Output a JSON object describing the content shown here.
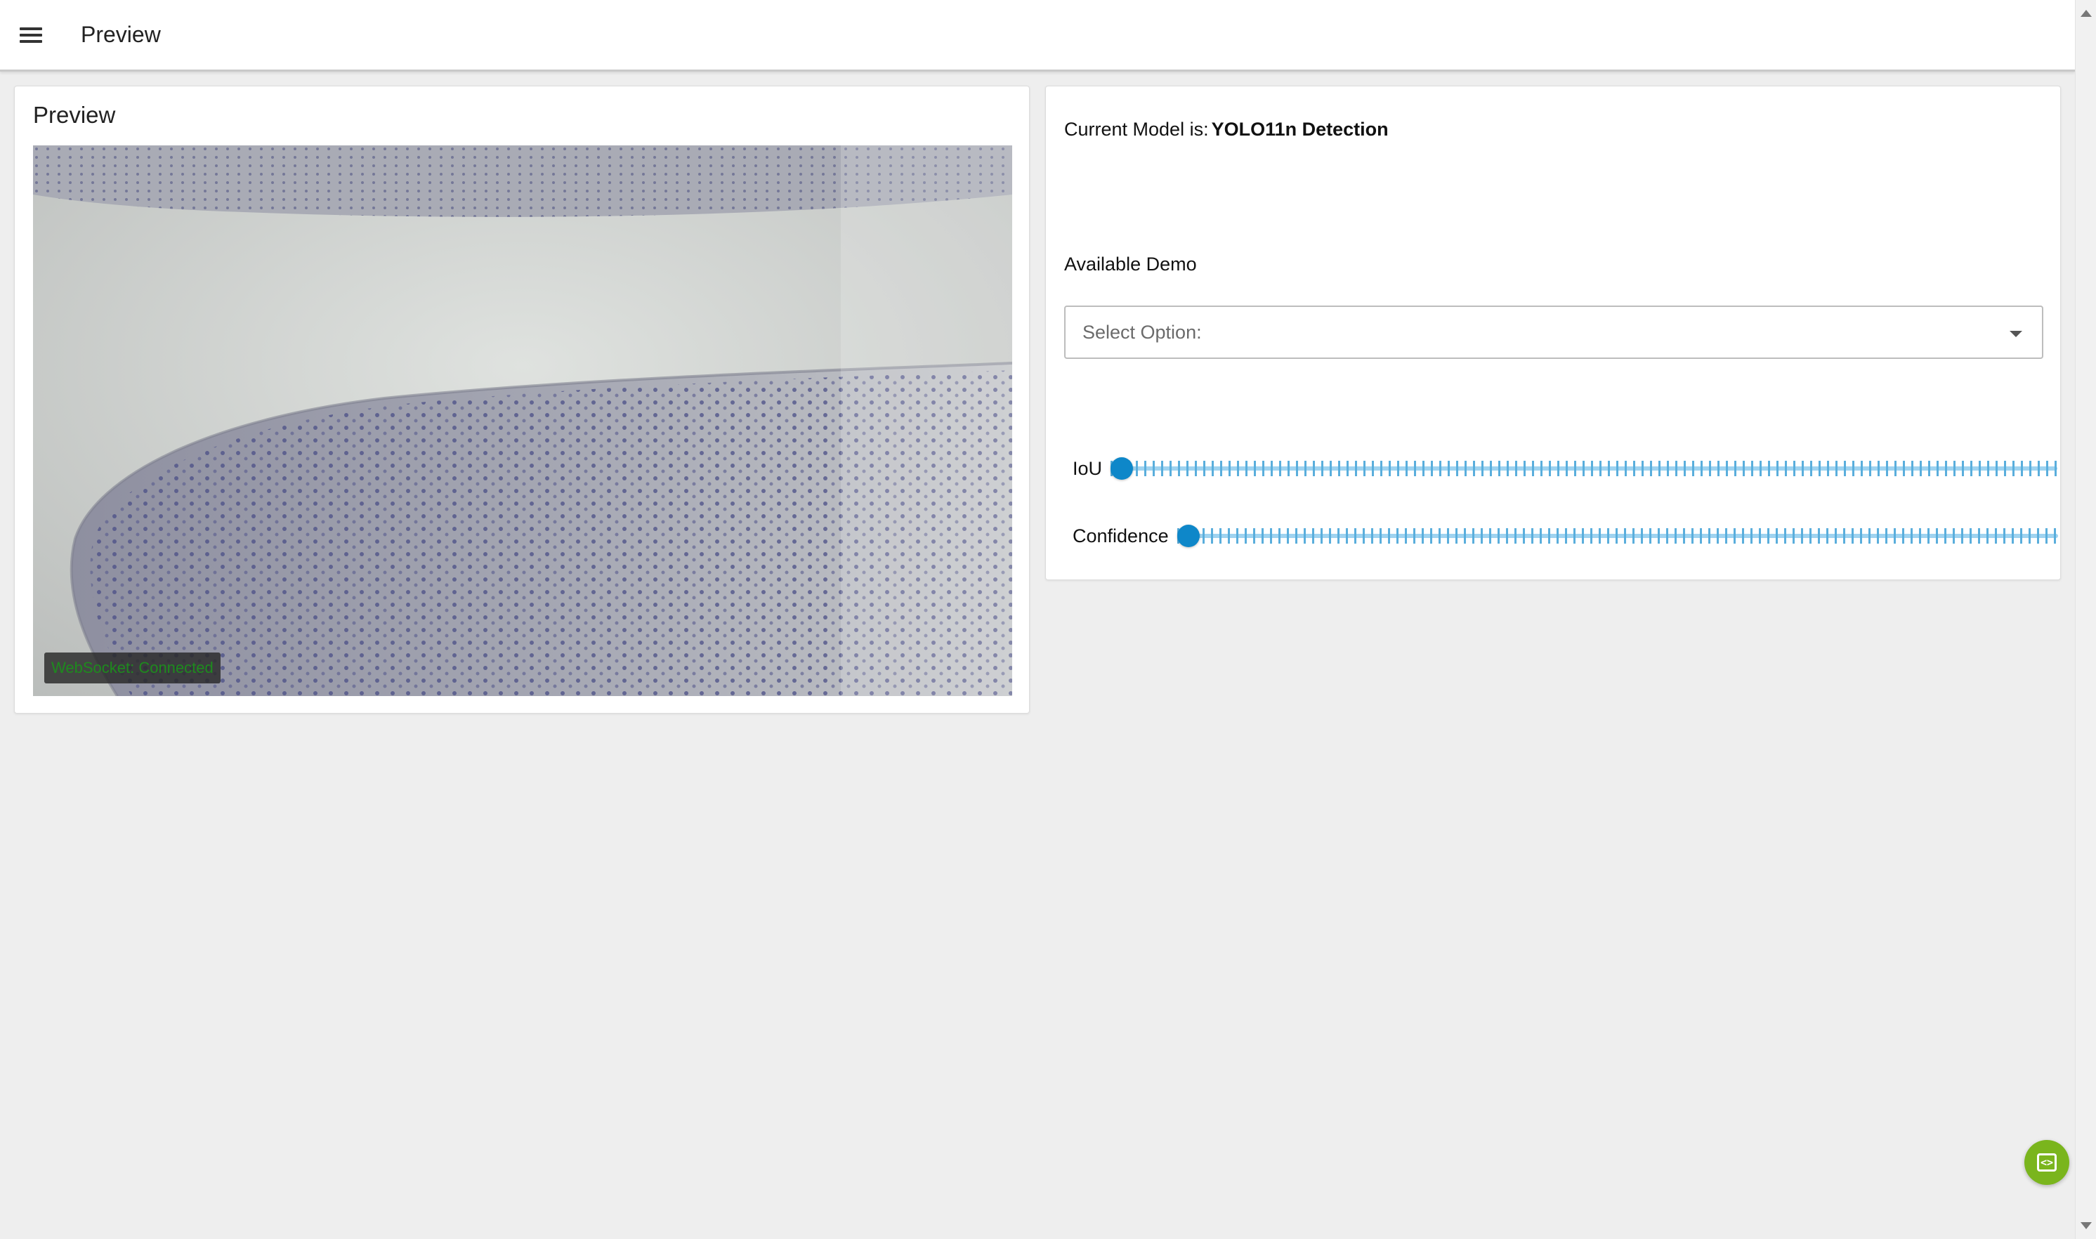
{
  "appbar": {
    "title": "Preview",
    "menu_icon": "hamburger-menu-icon"
  },
  "preview": {
    "title": "Preview",
    "video_description_icon": "microscope-camera-stream",
    "websocket_status": "WebSocket: Connected",
    "status_color": "#1e8a1e"
  },
  "controls": {
    "model_label": "Current Model is:",
    "model_name": "YOLO11n Detection",
    "demo_label": "Available Demo",
    "select_placeholder": "Select Option:",
    "sliders": [
      {
        "label": "IoU",
        "value": 0
      },
      {
        "label": "Confidence",
        "value": 0
      }
    ]
  },
  "fab": {
    "icon": "code-screen-icon"
  },
  "colors": {
    "accent": "#0e87c9",
    "fab": "#7ab51d",
    "background": "#eeeeee"
  }
}
